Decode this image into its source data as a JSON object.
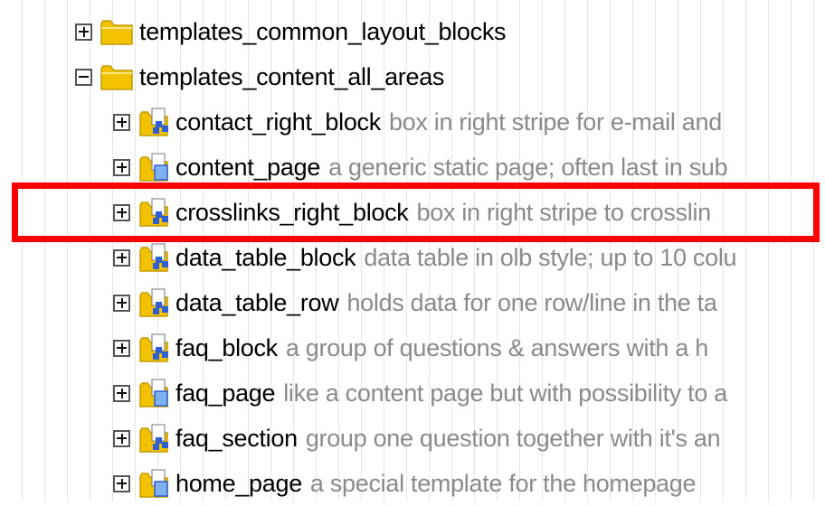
{
  "tree": {
    "items": [
      {
        "name": "templates_common_layout_blocks",
        "description": "",
        "type": "folder",
        "expanded": false
      },
      {
        "name": "templates_content_all_areas",
        "description": "",
        "type": "folder",
        "expanded": true
      },
      {
        "name": "contact_right_block",
        "description": "box in right stripe for e-mail and",
        "type": "template-block",
        "expanded": false
      },
      {
        "name": "content_page",
        "description": "a generic static page; often last in sub",
        "type": "template-page",
        "expanded": false
      },
      {
        "name": "crosslinks_right_block",
        "description": "box in right stripe to crosslin",
        "type": "template-block",
        "expanded": false,
        "highlighted": true
      },
      {
        "name": "data_table_block",
        "description": "data table in olb style; up to 10 colu",
        "type": "template-block",
        "expanded": false
      },
      {
        "name": "data_table_row",
        "description": "holds data for one row/line in the ta",
        "type": "template-block",
        "expanded": false
      },
      {
        "name": "faq_block",
        "description": "a group of questions & answers with a h",
        "type": "template-block",
        "expanded": false
      },
      {
        "name": "faq_page",
        "description": "like a content page but with possibility to a",
        "type": "template-page",
        "expanded": false
      },
      {
        "name": "faq_section",
        "description": "group one question together with it's an",
        "type": "template-block",
        "expanded": false
      },
      {
        "name": "home_page",
        "description": "a special template for the homepage",
        "type": "template-page",
        "expanded": false
      }
    ]
  },
  "colors": {
    "highlight_border": "#ff0000",
    "description_text": "#8a8a8a",
    "folder_yellow": "#f2c200",
    "block_blue": "#2f5fd0",
    "page_blue": "#7fb0f0"
  }
}
